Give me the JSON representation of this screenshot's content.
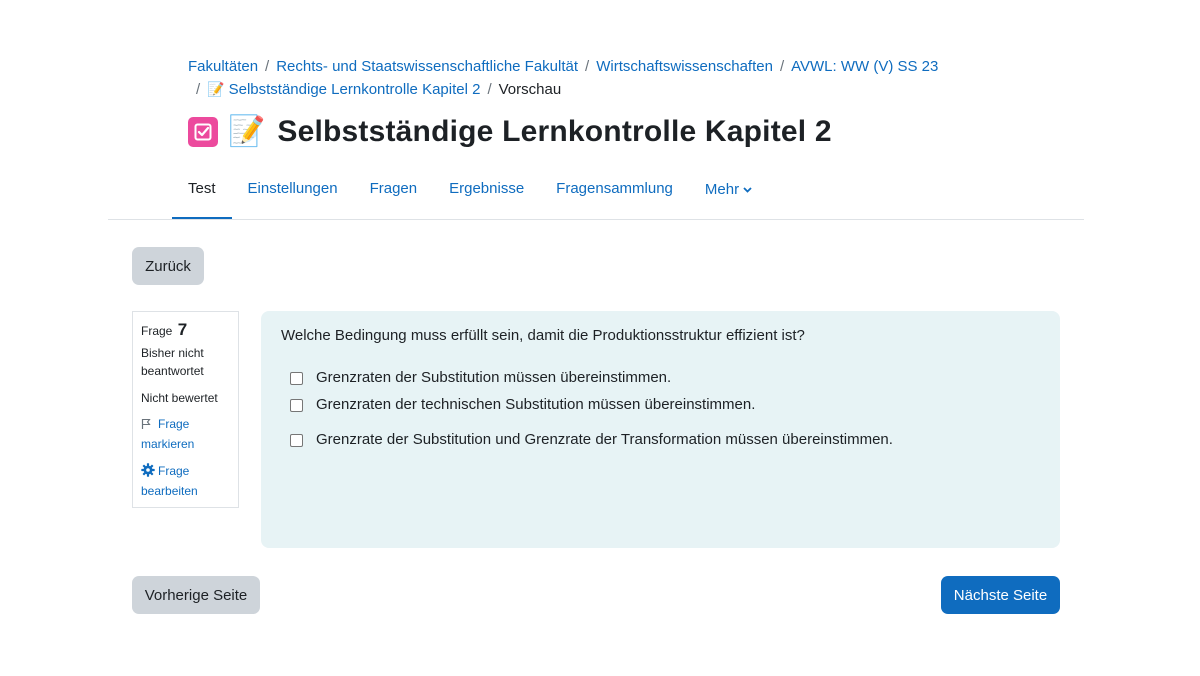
{
  "breadcrumb": {
    "items": [
      "Fakultäten",
      "Rechts- und Staatswissenschaftliche Fakultät",
      "Wirtschaftswissenschaften",
      "AVWL: WW (V) SS 23",
      "Selbstständige Lernkontrolle Kapitel 2"
    ],
    "current": "Vorschau",
    "separator": "/"
  },
  "page": {
    "title": "Selbstständige Lernkontrolle Kapitel 2",
    "module_icon": "quiz-checkbox-icon",
    "title_emoji": "📝"
  },
  "tabs": [
    {
      "label": "Test",
      "active": true
    },
    {
      "label": "Einstellungen",
      "active": false
    },
    {
      "label": "Fragen",
      "active": false
    },
    {
      "label": "Ergebnisse",
      "active": false
    },
    {
      "label": "Fragensammlung",
      "active": false
    },
    {
      "label": "Mehr",
      "active": false
    }
  ],
  "buttons": {
    "back": "Zurück",
    "previous": "Vorherige Seite",
    "next": "Nächste Seite"
  },
  "question_info": {
    "label": "Frage",
    "number": "7",
    "state": "Bisher nicht beantwortet",
    "grade": "Nicht bewertet",
    "flag_label": "Frage markieren",
    "edit_label": "Frage bearbeiten"
  },
  "question": {
    "text": "Welche Bedingung muss erfüllt sein, damit die Produktionsstruktur effizient ist?",
    "answers": [
      "Grenzraten der Substitution müssen übereinstimmen.",
      "Grenzraten der technischen Substitution müssen übereinstimmen.",
      "Grenzrate der Substitution und Grenzrate der Transformation müssen übereinstimmen."
    ]
  },
  "colors": {
    "link": "#0f6cbf",
    "module_icon_bg": "#ec4a9d",
    "question_bg": "#e7f3f5",
    "secondary_button": "#ced4da",
    "primary_button": "#0f6cbf"
  }
}
